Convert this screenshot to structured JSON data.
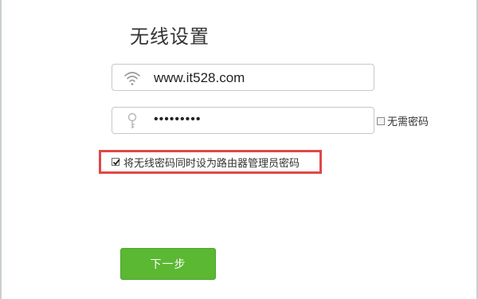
{
  "page": {
    "title": "无线设置"
  },
  "ssid_field": {
    "icon": "wifi-icon",
    "value": "www.it528.com"
  },
  "password_field": {
    "icon": "key-icon",
    "value": "•••••••••"
  },
  "no_password": {
    "label": "无需密码",
    "checked": false
  },
  "admin_option": {
    "label": "将无线密码同时设为路由器管理员密码",
    "checked": true,
    "highlight_color": "#e04848"
  },
  "next_button": {
    "label": "下一步",
    "color": "#5bb833"
  }
}
